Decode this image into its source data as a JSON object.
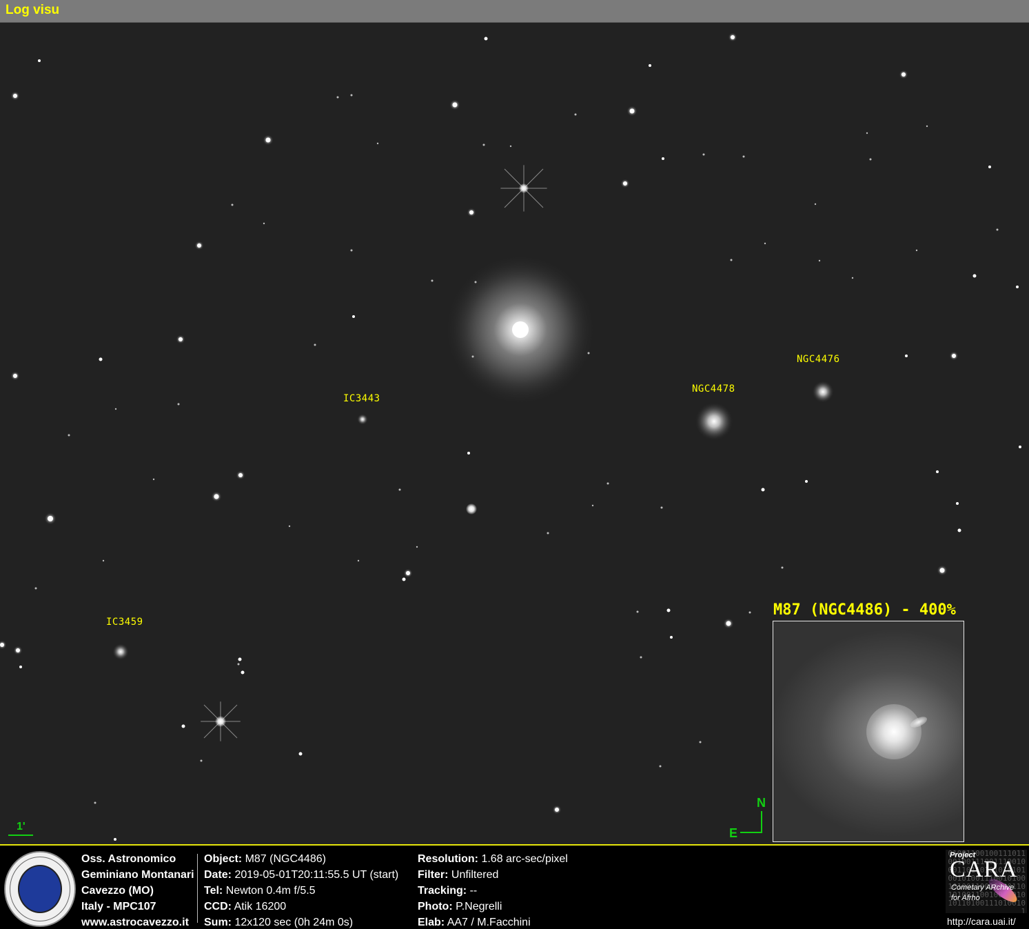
{
  "window": {
    "title": "Log visu"
  },
  "labels": {
    "ic3443": "IC3443",
    "ngc4478": "NGC4478",
    "ngc4476": "NGC4476",
    "ic3459": "IC3459"
  },
  "inset": {
    "title": "M87 (NGC4486) - 400%"
  },
  "scale": {
    "label": "1'"
  },
  "compass": {
    "north": "N",
    "east": "E"
  },
  "observatory": {
    "line1": "Oss. Astronomico",
    "line2": "Geminiano Montanari",
    "line3": "Cavezzo (MO)",
    "line4": "Italy - MPC107",
    "line5": "www.astrocavezzo.it"
  },
  "info": {
    "object_key": "Object:",
    "object_val": "M87 (NGC4486)",
    "date_key": "Date:",
    "date_val": "2019-05-01T20:11:55.5 UT (start)",
    "tel_key": "Tel:",
    "tel_val": "Newton 0.4m f/5.5",
    "ccd_key": "CCD:",
    "ccd_val": "Atik 16200",
    "sum_key": "Sum:",
    "sum_val": "12x120 sec (0h 24m 0s)",
    "res_key": "Resolution:",
    "res_val": "1.68 arc-sec/pixel",
    "filter_key": "Filter:",
    "filter_val": "Unfiltered",
    "track_key": "Tracking:",
    "track_val": "--",
    "photo_key": "Photo:",
    "photo_val": "P.Negrelli",
    "elab_key": "Elab:",
    "elab_val": "AA7 / M.Facchini"
  },
  "cara": {
    "project": "Project",
    "name": "CARA",
    "sub1": "Cometary ARchive",
    "sub2": "for Afrho",
    "url": "http://cara.uai.it/",
    "binary": "010011001001110110010011100111001000110110101010101001010011100101001010011001010011010100110010011010101101001110100101"
  },
  "colors": {
    "label": "#ffff00",
    "compass": "#12d012",
    "sky": "#222222"
  }
}
